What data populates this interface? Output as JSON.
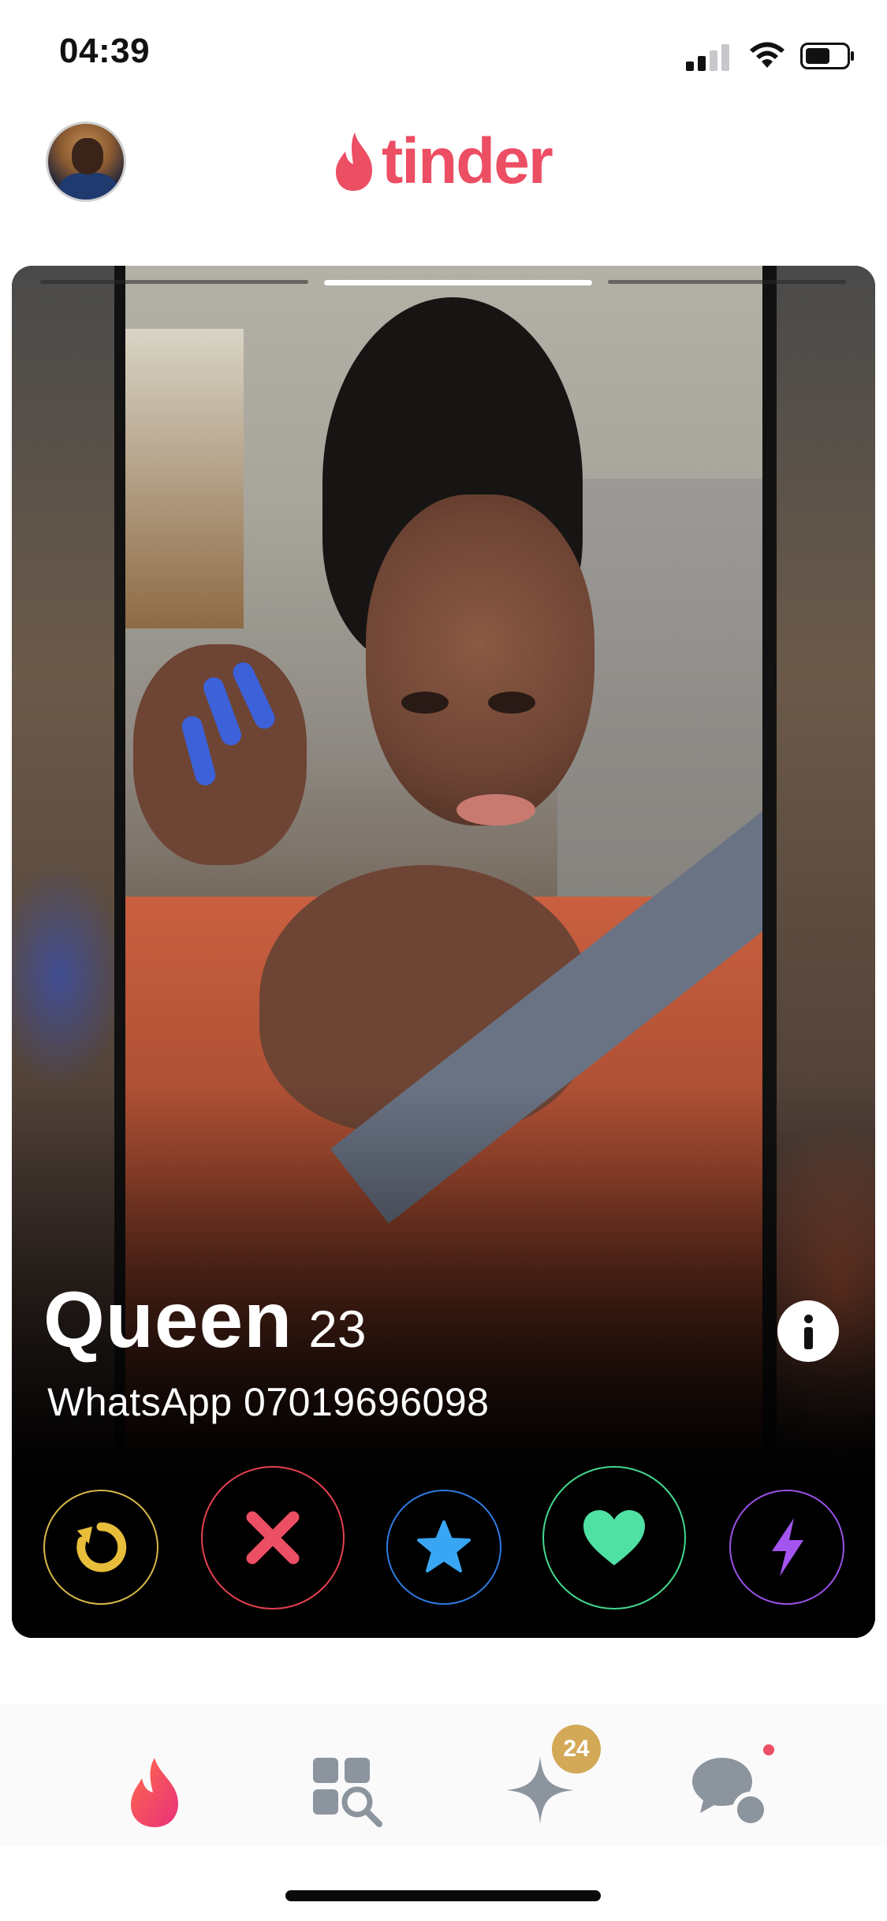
{
  "status_bar": {
    "time": "04:39",
    "signal_icon": "cellular-signal-icon",
    "wifi_icon": "wifi-icon",
    "battery_icon": "battery-icon",
    "battery_level": 0.55
  },
  "header": {
    "avatar_icon": "profile-avatar",
    "logo_icon": "tinder-flame-icon",
    "logo_text": "tinder",
    "brand_color": "#ec4e63"
  },
  "card": {
    "photo_index": 1,
    "photo_count": 3,
    "name": "Queen",
    "age": "23",
    "bio": "WhatsApp 07019696098",
    "info_icon": "info-icon"
  },
  "actions": {
    "rewind": {
      "icon": "rewind-icon",
      "color": "#d8b949"
    },
    "nope": {
      "icon": "close-icon",
      "color": "#e5404f"
    },
    "super_like": {
      "icon": "star-icon",
      "color": "#2f7ae0"
    },
    "like": {
      "icon": "heart-icon",
      "color": "#42d98f"
    },
    "boost": {
      "icon": "lightning-icon",
      "color": "#9a52e6"
    }
  },
  "bottom_nav": {
    "discover_icon": "flame-icon",
    "explore_icon": "explore-grid-icon",
    "likes_icon": "sparkle-icon",
    "likes_badge": "24",
    "chat_icon": "chat-bubbles-icon",
    "chat_has_unread": true
  }
}
